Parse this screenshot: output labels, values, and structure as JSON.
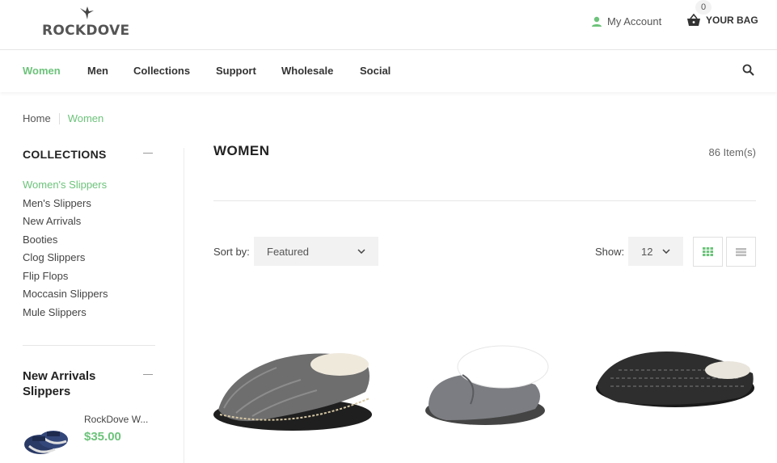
{
  "header": {
    "logo_text": "ROCKDOVE",
    "account_label": "My Account",
    "bag_label": "YOUR BAG",
    "bag_count": "0"
  },
  "nav": {
    "items": [
      "Women",
      "Men",
      "Collections",
      "Support",
      "Wholesale",
      "Social"
    ],
    "active": "Women"
  },
  "breadcrumb": {
    "home": "Home",
    "current": "Women"
  },
  "sidebar": {
    "collections_title": "COLLECTIONS",
    "collections": [
      "Women's Slippers",
      "Men's Slippers",
      "New Arrivals",
      "Booties",
      "Clog Slippers",
      "Flip Flops",
      "Moccasin Slippers",
      "Mule Slippers"
    ],
    "new_arrivals_title": "New Arrivals Slippers",
    "new_arrival": {
      "name": "RockDove W...",
      "price": "$35.00"
    }
  },
  "main": {
    "title": "WOMEN",
    "item_count": "86 Item(s)",
    "sort_label": "Sort by:",
    "sort_value": "Featured",
    "show_label": "Show:",
    "show_value": "12"
  },
  "colors": {
    "accent": "#6cc37a",
    "text": "#333333",
    "muted": "#f2f2f2"
  },
  "icons": [
    "bird-logo-icon",
    "user-icon",
    "basket-icon",
    "search-icon",
    "grid-view-icon",
    "list-view-icon",
    "chevron-down-icon"
  ]
}
